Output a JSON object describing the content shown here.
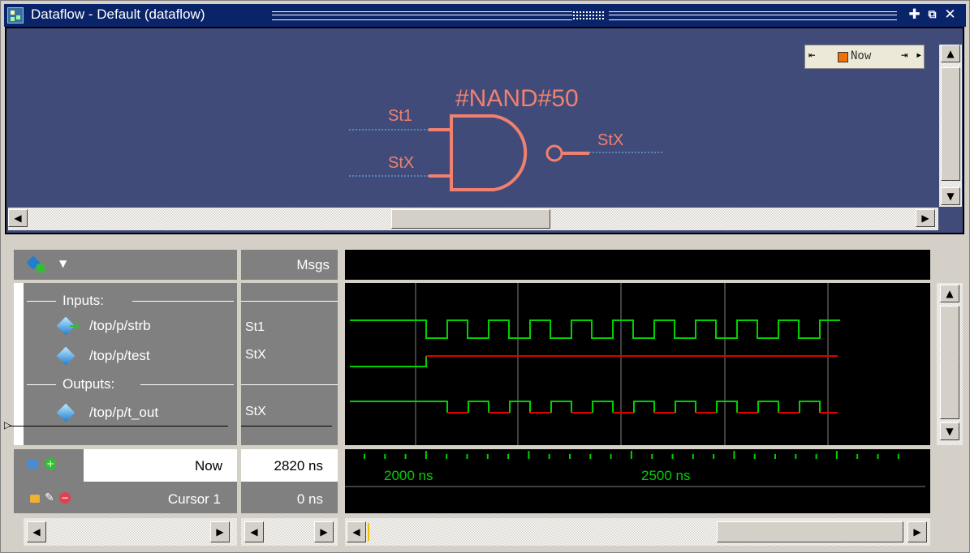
{
  "window": {
    "title": "Dataflow - Default (dataflow)",
    "buttons": [
      "maximize",
      "undock",
      "close"
    ]
  },
  "dataflow": {
    "gate_name": "#NAND#50",
    "input_a_value": "St1",
    "input_b_value": "StX",
    "output_value": "StX",
    "now_label": "Now"
  },
  "wave": {
    "msgs_header": "Msgs",
    "signals": [
      {
        "kind": "divider",
        "label": "Inputs:"
      },
      {
        "kind": "signal",
        "label": "/top/p/strb",
        "value": "St1"
      },
      {
        "kind": "signal",
        "label": "/top/p/test",
        "value": "StX"
      },
      {
        "kind": "divider",
        "label": "Outputs:"
      },
      {
        "kind": "signal",
        "label": "/top/p/t_out",
        "value": "StX"
      }
    ],
    "now_label": "Now",
    "now_value": "2820 ns",
    "cursor_label": "Cursor 1",
    "cursor_value": "0 ns",
    "time_labels": [
      "2000 ns",
      "2500 ns"
    ]
  },
  "colors": {
    "titlebar": "#0a246a",
    "dataflow_bg": "#404b7a",
    "gate": "#f08070",
    "wave_green": "#00d000",
    "wave_red": "#e00000"
  }
}
